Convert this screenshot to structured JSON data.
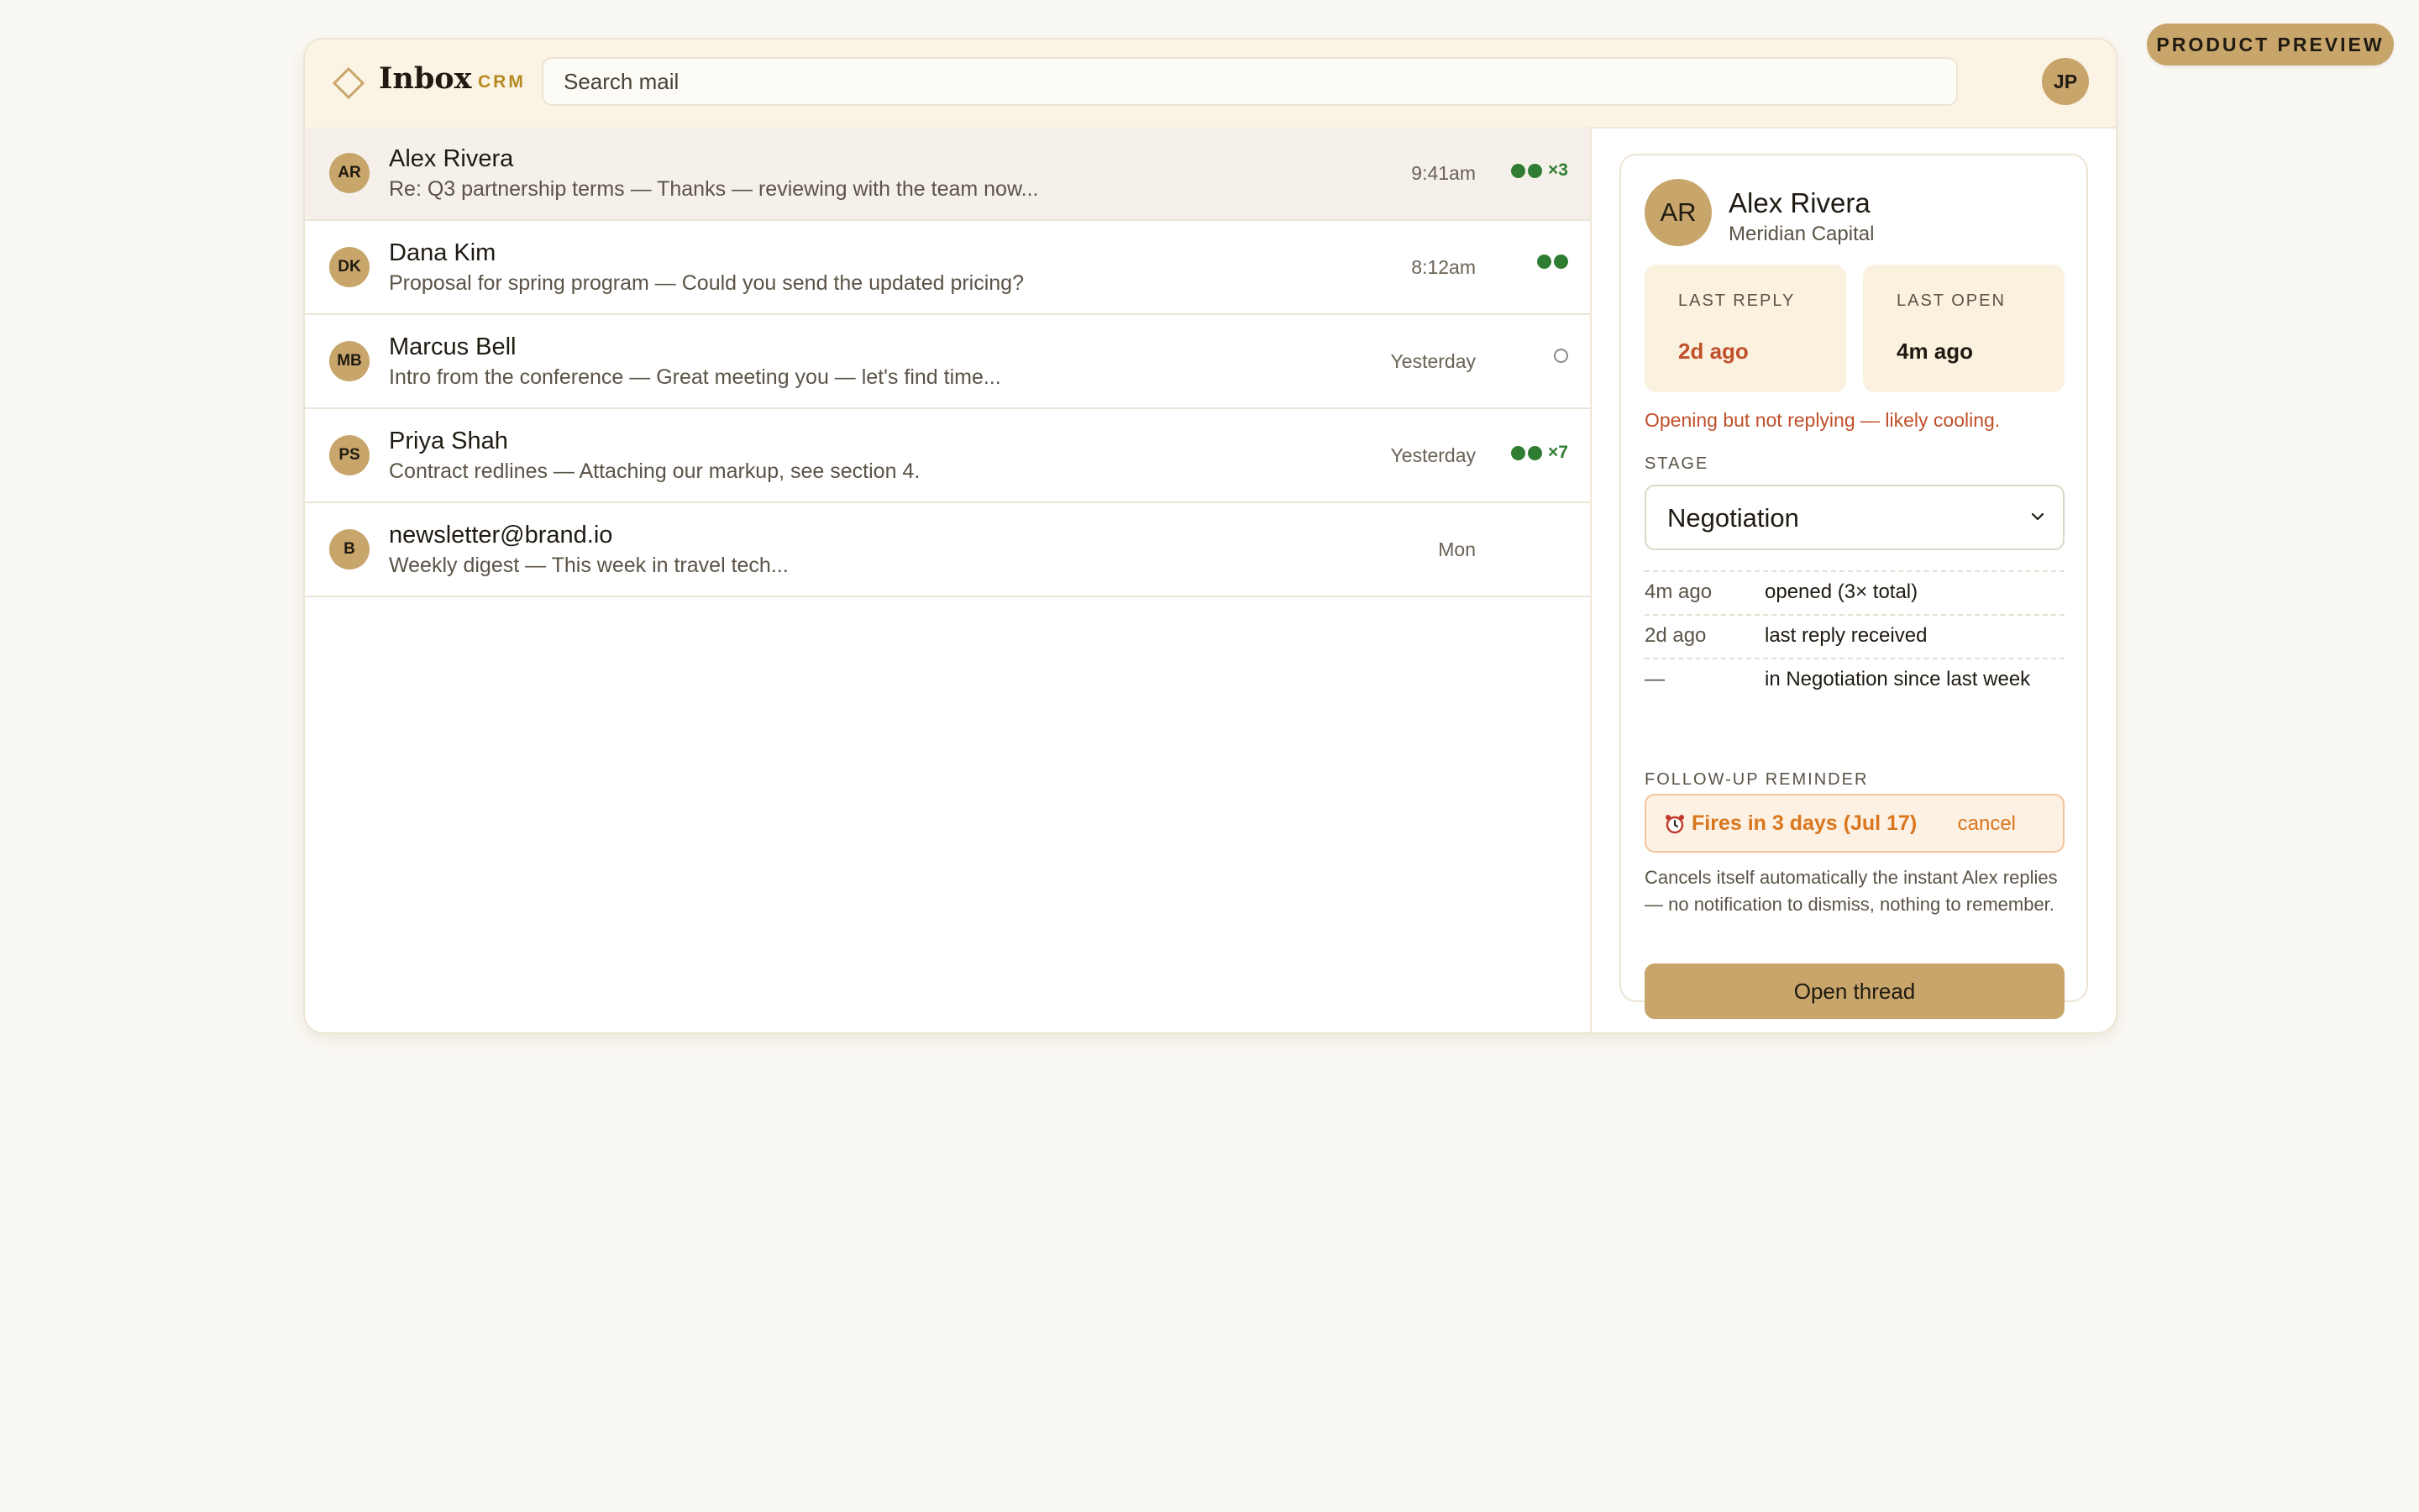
{
  "preview_badge": "PRODUCT PREVIEW",
  "header": {
    "title": "Inbox",
    "tag": "CRM",
    "search_placeholder": "Search mail",
    "user_initials": "JP"
  },
  "inbox": [
    {
      "initials": "AR",
      "name": "Alex Rivera",
      "snippet": "Re: Q3 partnership terms — Thanks — reviewing with the team now...",
      "time": "9:41am",
      "opens": "double",
      "count": "×3",
      "selected": true
    },
    {
      "initials": "DK",
      "name": "Dana Kim",
      "snippet": "Proposal for spring program — Could you send the updated pricing?",
      "time": "8:12am",
      "opens": "double",
      "count": "",
      "selected": false
    },
    {
      "initials": "MB",
      "name": "Marcus Bell",
      "snippet": "Intro from the conference — Great meeting you — let's find time...",
      "time": "Yesterday",
      "opens": "none",
      "count": "",
      "selected": false
    },
    {
      "initials": "PS",
      "name": "Priya Shah",
      "snippet": "Contract redlines — Attaching our markup, see section 4.",
      "time": "Yesterday",
      "opens": "double",
      "count": "×7",
      "selected": false
    },
    {
      "initials": "B",
      "name": "newsletter@brand.io",
      "snippet": "Weekly digest — This week in travel tech...",
      "time": "Mon",
      "opens": "",
      "count": "",
      "selected": false
    }
  ],
  "contact": {
    "initials": "AR",
    "name": "Alex Rivera",
    "company": "Meridian Capital",
    "last_reply_label": "LAST REPLY",
    "last_reply_value": "2d ago",
    "last_open_label": "LAST OPEN",
    "last_open_value": "4m ago",
    "warning": "Opening but not replying — likely cooling.",
    "stage_label": "STAGE",
    "stage_value": "Negotiation",
    "timeline": [
      {
        "when": "4m ago",
        "what": "opened (3× total)"
      },
      {
        "when": "2d ago",
        "what": "last reply received"
      },
      {
        "when": "—",
        "what": "in Negotiation since last week"
      }
    ],
    "reminder_label": "FOLLOW-UP REMINDER",
    "reminder_text": "Fires in 3 days (Jul 17)",
    "reminder_cancel": "cancel",
    "note": "Cancels itself automatically the instant Alex replies — no notification to dismiss, nothing to remember.",
    "open_button": "Open thread"
  },
  "colors": {
    "accent": "#c8a56a",
    "open_indicator": "#2f7d32",
    "warning": "#c0502a",
    "reminder": "#d9761e"
  }
}
